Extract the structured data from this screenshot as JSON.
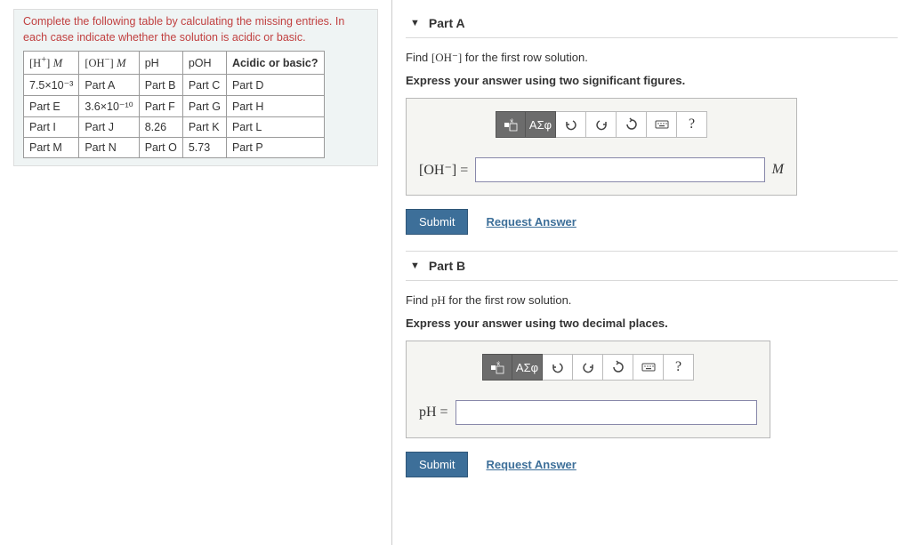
{
  "left": {
    "instruction": "Complete the following table by calculating the missing entries. In each case indicate whether the solution is acidic or basic.",
    "headers": {
      "h": "[H⁺] M",
      "oh": "[OH⁻] M",
      "ph": "pH",
      "poh": "pOH",
      "ab": "Acidic or basic?"
    },
    "rows": [
      {
        "h": "7.5×10⁻³",
        "oh": "Part A",
        "ph": "Part B",
        "poh": "Part C",
        "ab": "Part D"
      },
      {
        "h": "Part E",
        "oh": "3.6×10⁻¹⁰",
        "ph": "Part F",
        "poh": "Part G",
        "ab": "Part H"
      },
      {
        "h": "Part I",
        "oh": "Part J",
        "ph": "8.26",
        "poh": "Part K",
        "ab": "Part L"
      },
      {
        "h": "Part M",
        "oh": "Part N",
        "ph": "Part O",
        "poh": "5.73",
        "ab": "Part P"
      }
    ]
  },
  "partA": {
    "title": "Part A",
    "find_prefix": "Find ",
    "find_var": "[OH⁻]",
    "find_suffix": " for the first row solution.",
    "express": "Express your answer using two significant figures.",
    "label": "[OH⁻] =",
    "unit": "M",
    "submit": "Submit",
    "request": "Request Answer",
    "greek": "ΑΣφ",
    "help": "?"
  },
  "partB": {
    "title": "Part B",
    "find_prefix": "Find ",
    "find_var": "pH",
    "find_suffix": " for the first row solution.",
    "express": "Express your answer using two decimal places.",
    "label": "pH =",
    "submit": "Submit",
    "request": "Request Answer",
    "greek": "ΑΣφ",
    "help": "?"
  }
}
